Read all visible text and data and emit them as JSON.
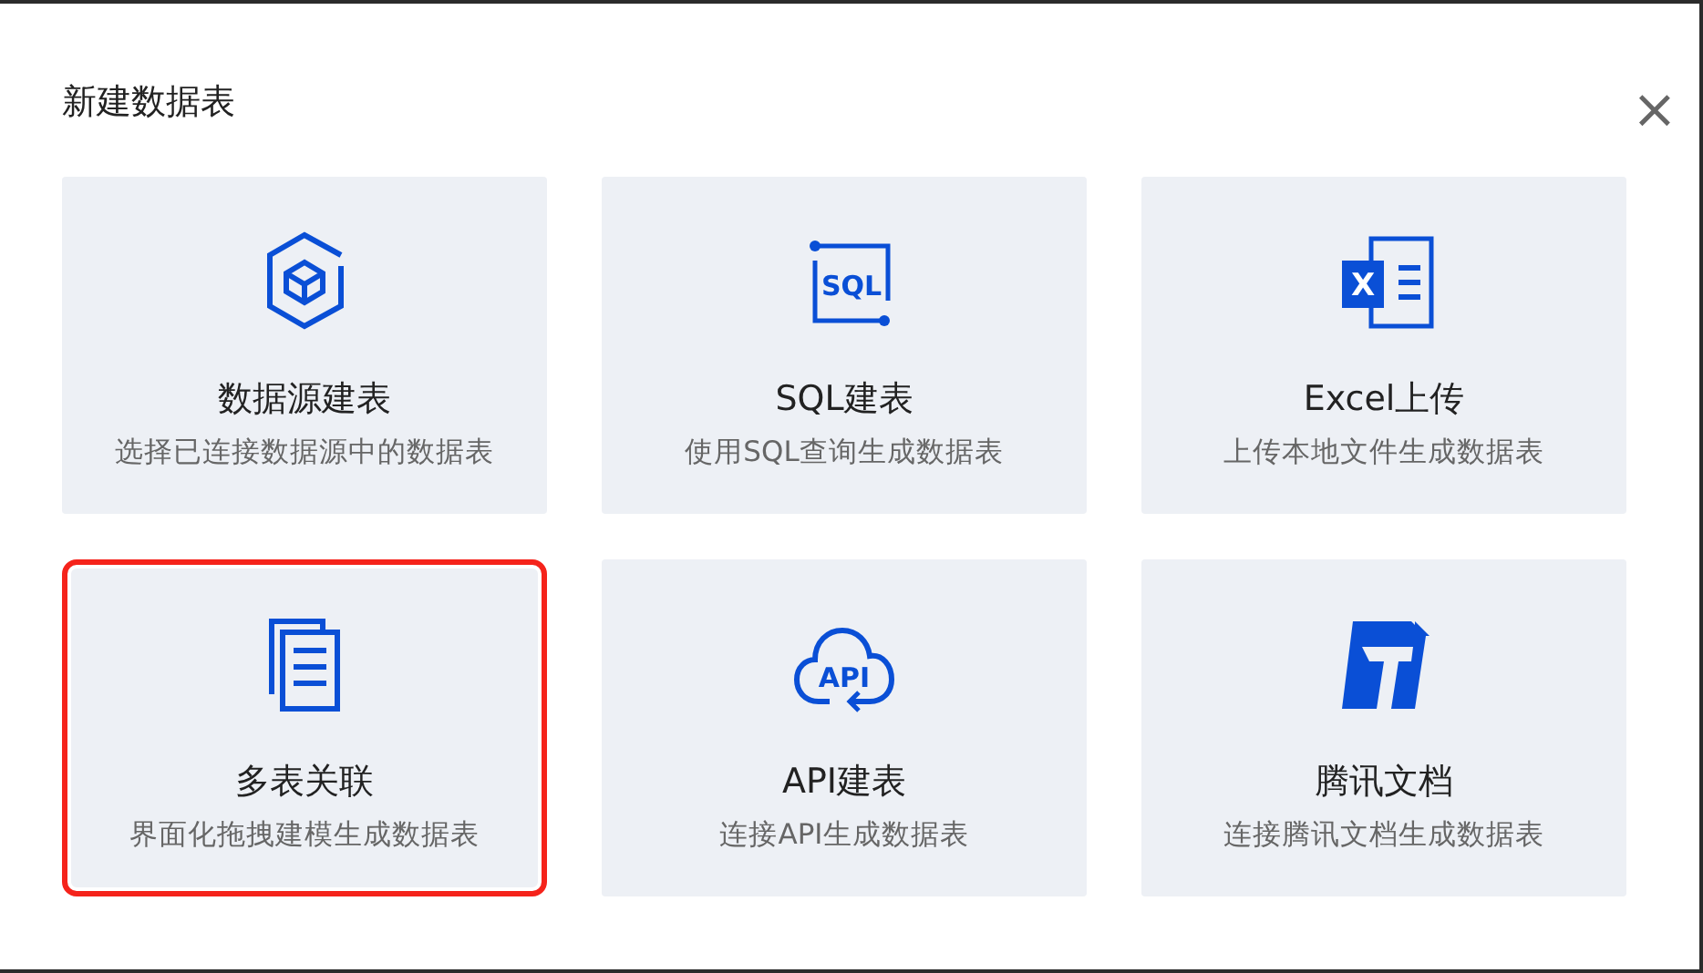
{
  "dialog": {
    "title": "新建数据表",
    "close": "×"
  },
  "options": [
    {
      "kind": "datasource",
      "title": "数据源建表",
      "description": "选择已连接数据源中的数据表",
      "highlighted": false
    },
    {
      "kind": "sql",
      "icon_text": "SQL",
      "title": "SQL建表",
      "description": "使用SQL查询生成数据表",
      "highlighted": false
    },
    {
      "kind": "excel",
      "icon_text": "X",
      "title": "Excel上传",
      "description": "上传本地文件生成数据表",
      "highlighted": false
    },
    {
      "kind": "multi",
      "title": "多表关联",
      "description": "界面化拖拽建模生成数据表",
      "highlighted": true
    },
    {
      "kind": "api",
      "icon_text": "API",
      "title": "API建表",
      "description": "连接API生成数据表",
      "highlighted": false
    },
    {
      "kind": "doc",
      "title": "腾讯文档",
      "description": "连接腾讯文档生成数据表",
      "highlighted": false
    }
  ]
}
